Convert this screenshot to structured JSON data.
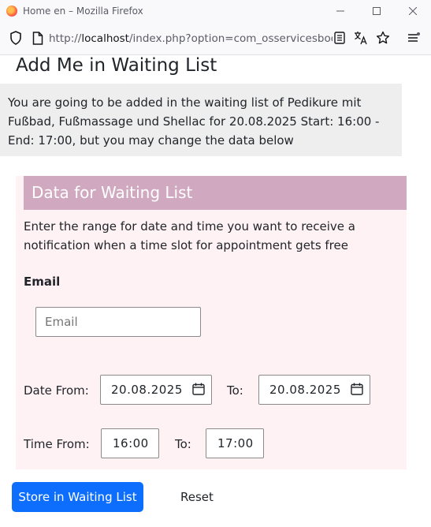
{
  "browser": {
    "window_title": "Home en – Mozilla Firefox",
    "url_prefix": "http://",
    "url_host": "localhost",
    "url_path": "/index.php?option=com_osservicesbookin"
  },
  "page": {
    "title": "Add Me in Waiting List",
    "notice": "You are going to be added in the waiting list of Pedikure mit Fußbad, Fußmassage und Shellac for 20.08.2025 Start: 16:00 - End: 17:00, but you may change the data below"
  },
  "form": {
    "section_title": "Data for Waiting List",
    "description": "Enter the range for date and time you want to receive a notification when a time slot for appointment gets free",
    "email_label": "Email",
    "email_placeholder": "Email",
    "email_value": "",
    "date_from_label": "Date From:",
    "date_from_value": "20.08.2025",
    "date_to_label": "To:",
    "date_to_value": "20.08.2025",
    "time_from_label": "Time From:",
    "time_from_value": "16:00",
    "time_to_label": "To:",
    "time_to_value": "17:00",
    "submit_label": "Store in Waiting List",
    "reset_label": "Reset"
  },
  "colors": {
    "primary": "#0d6efd",
    "section_header": "#d0a9c0",
    "section_background": "#fff2f5",
    "notice_background": "#eeeeee"
  }
}
